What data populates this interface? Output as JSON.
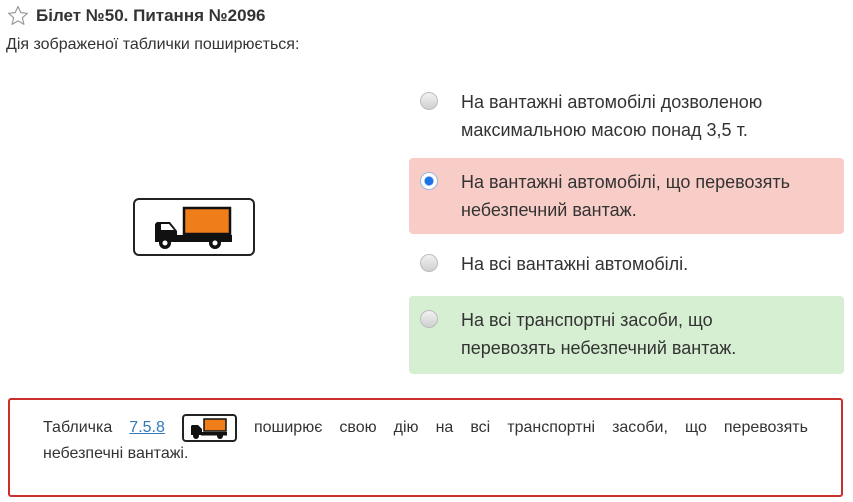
{
  "header": {
    "title": "Білет №50. Питання №2096"
  },
  "question": {
    "text": "Дія зображеної таблички поширюється:"
  },
  "answers": [
    {
      "line1": "На вантажні автомобілі дозволеною",
      "line2": "максимальною масою понад 3,5 т.",
      "state": "default"
    },
    {
      "line1": "На вантажні автомобілі, що перевозять",
      "line2": "небезпечний вантаж.",
      "state": "selected-wrong"
    },
    {
      "line1": "На всі вантажні автомобілі.",
      "line2": "",
      "state": "default"
    },
    {
      "line1": "На всі транспортні засоби, що",
      "line2": "перевозять небезпечний вантаж.",
      "state": "correct"
    }
  ],
  "explanation": {
    "words": [
      "Табличка",
      "поширює",
      "свою",
      "дію",
      "на",
      "всі",
      "транспортні",
      "засоби,",
      "що",
      "перевозять"
    ],
    "link": "7.5.8",
    "line2": "небезпечні вантажі."
  },
  "colors": {
    "wrong_bg": "#f8cdc7",
    "correct_bg": "#d6efd2",
    "explanation_border": "#c9302c",
    "sign_orange": "#ef7d1a",
    "link": "#337ab7"
  },
  "icons": {
    "favorite": "star-outline-icon",
    "sign": "truck-dangerous-goods-sign"
  }
}
